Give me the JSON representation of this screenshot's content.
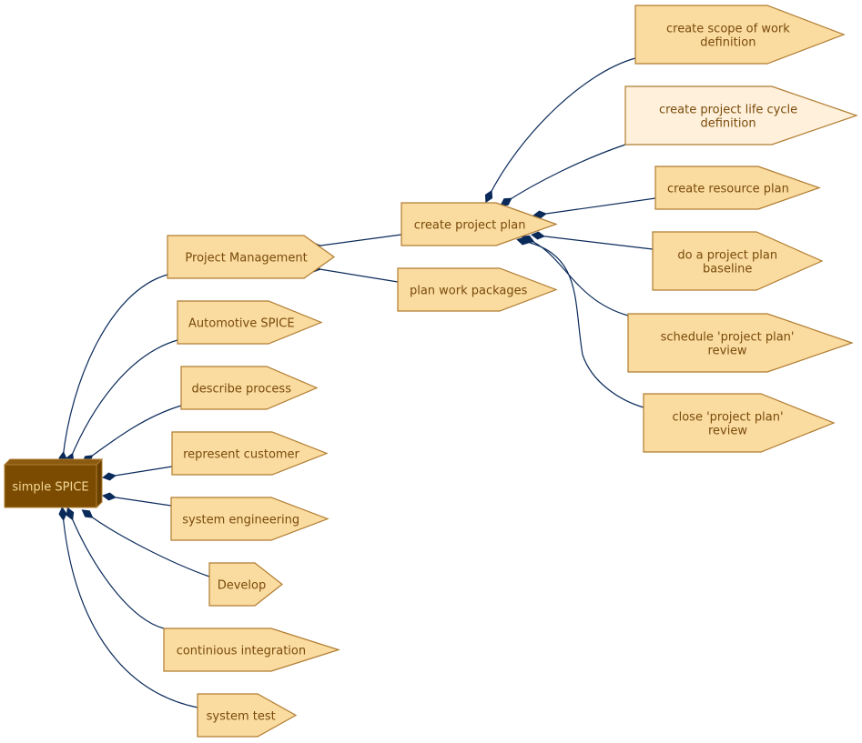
{
  "diagram": {
    "colors": {
      "node_fill": "#fadba0",
      "node_fill_light": "#fef0da",
      "node_stroke": "#b07c30",
      "root_fill": "#7a4b00",
      "root_stroke": "#b07c30",
      "root_text": "#f5d99a",
      "node_text": "#7a4b0c",
      "edge": "#0a2a5a"
    },
    "root": {
      "id": "simple-spice",
      "label": "simple SPICE"
    },
    "nodes": [
      {
        "id": "project-management",
        "lines": [
          "Project Management"
        ],
        "parent": "simple-spice",
        "style": "normal"
      },
      {
        "id": "automotive-spice",
        "lines": [
          "Automotive SPICE"
        ],
        "parent": "simple-spice",
        "style": "normal"
      },
      {
        "id": "describe-process",
        "lines": [
          "describe process"
        ],
        "parent": "simple-spice",
        "style": "normal"
      },
      {
        "id": "represent-customer",
        "lines": [
          "represent customer"
        ],
        "parent": "simple-spice",
        "style": "normal"
      },
      {
        "id": "system-engineering",
        "lines": [
          "system engineering"
        ],
        "parent": "simple-spice",
        "style": "normal"
      },
      {
        "id": "develop",
        "lines": [
          "Develop"
        ],
        "parent": "simple-spice",
        "style": "normal"
      },
      {
        "id": "continious-integration",
        "lines": [
          "continious integration"
        ],
        "parent": "simple-spice",
        "style": "normal"
      },
      {
        "id": "system-test",
        "lines": [
          "system test"
        ],
        "parent": "simple-spice",
        "style": "normal"
      },
      {
        "id": "create-project-plan",
        "lines": [
          "create project plan"
        ],
        "parent": "project-management",
        "style": "normal"
      },
      {
        "id": "plan-work-packages",
        "lines": [
          "plan work packages"
        ],
        "parent": "project-management",
        "style": "normal"
      },
      {
        "id": "create-scope-of-work-definition",
        "lines": [
          "create scope of work",
          "definition"
        ],
        "parent": "create-project-plan",
        "style": "normal"
      },
      {
        "id": "create-project-life-cycle-definition",
        "lines": [
          "create project life cycle",
          "definition"
        ],
        "parent": "create-project-plan",
        "style": "light"
      },
      {
        "id": "create-resource-plan",
        "lines": [
          "create resource plan"
        ],
        "parent": "create-project-plan",
        "style": "normal"
      },
      {
        "id": "do-a-project-plan-baseline",
        "lines": [
          "do a project plan",
          "baseline"
        ],
        "parent": "create-project-plan",
        "style": "normal"
      },
      {
        "id": "schedule-project-plan-review",
        "lines": [
          "schedule 'project plan'",
          "review"
        ],
        "parent": "create-project-plan",
        "style": "normal"
      },
      {
        "id": "close-project-plan-review",
        "lines": [
          "close 'project plan'",
          "review"
        ],
        "parent": "create-project-plan",
        "style": "normal"
      }
    ]
  }
}
